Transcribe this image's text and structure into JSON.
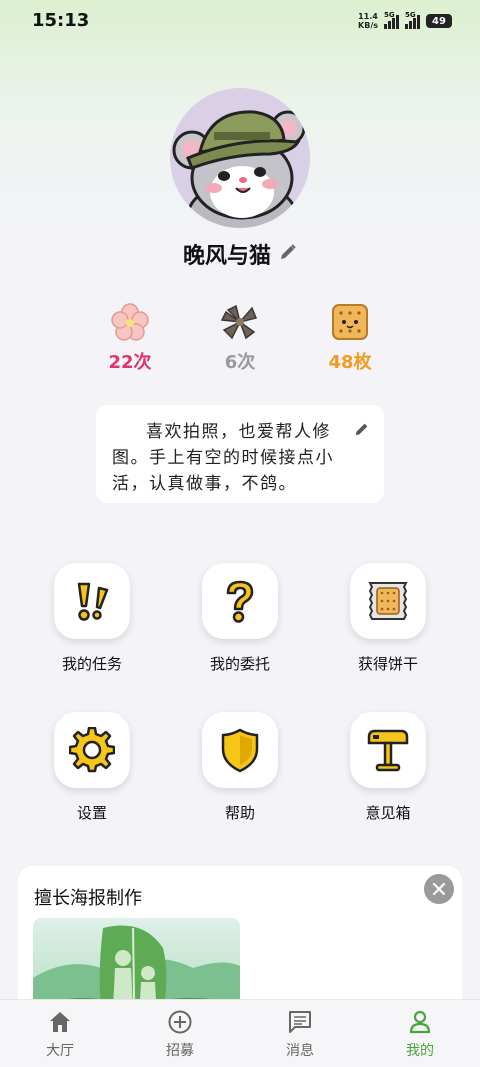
{
  "status_bar": {
    "time": "15:13",
    "net_speed_value": "11.4",
    "net_speed_unit": "KB/s",
    "signal_1_label": "5G",
    "signal_2_label": "5G",
    "battery": "49"
  },
  "profile": {
    "username": "晚风与猫",
    "avatar_icon": "hamster-avatar"
  },
  "stats": [
    {
      "icon": "cherry-blossom-icon",
      "value": "22次",
      "color": "#e0356b"
    },
    {
      "icon": "withered-flower-icon",
      "value": "6次",
      "color": "#999999"
    },
    {
      "icon": "biscuit-icon",
      "value": "48枚",
      "color": "#f29c1f"
    }
  ],
  "bio": {
    "text": "喜欢拍照，也爱帮人修图。手上有空的时候接点小活，认真做事，不鸽。"
  },
  "menu": [
    {
      "icon": "exclamation-icon",
      "label": "我的任务"
    },
    {
      "icon": "question-icon",
      "label": "我的委托"
    },
    {
      "icon": "biscuit-package-icon",
      "label": "获得饼干"
    },
    {
      "icon": "gear-icon",
      "label": "设置"
    },
    {
      "icon": "shield-icon",
      "label": "帮助"
    },
    {
      "icon": "mailbox-icon",
      "label": "意见箱"
    }
  ],
  "promo": {
    "title": "擅长海报制作"
  },
  "tabs": [
    {
      "icon": "home-icon",
      "label": "大厅",
      "active": false
    },
    {
      "icon": "plus-circle-icon",
      "label": "招募",
      "active": false
    },
    {
      "icon": "message-icon",
      "label": "消息",
      "active": false
    },
    {
      "icon": "person-icon",
      "label": "我的",
      "active": true
    }
  ],
  "colors": {
    "accent": "#4aa43e",
    "header_gradient_top": "#dcf0d0",
    "background": "#f3f3f8"
  }
}
